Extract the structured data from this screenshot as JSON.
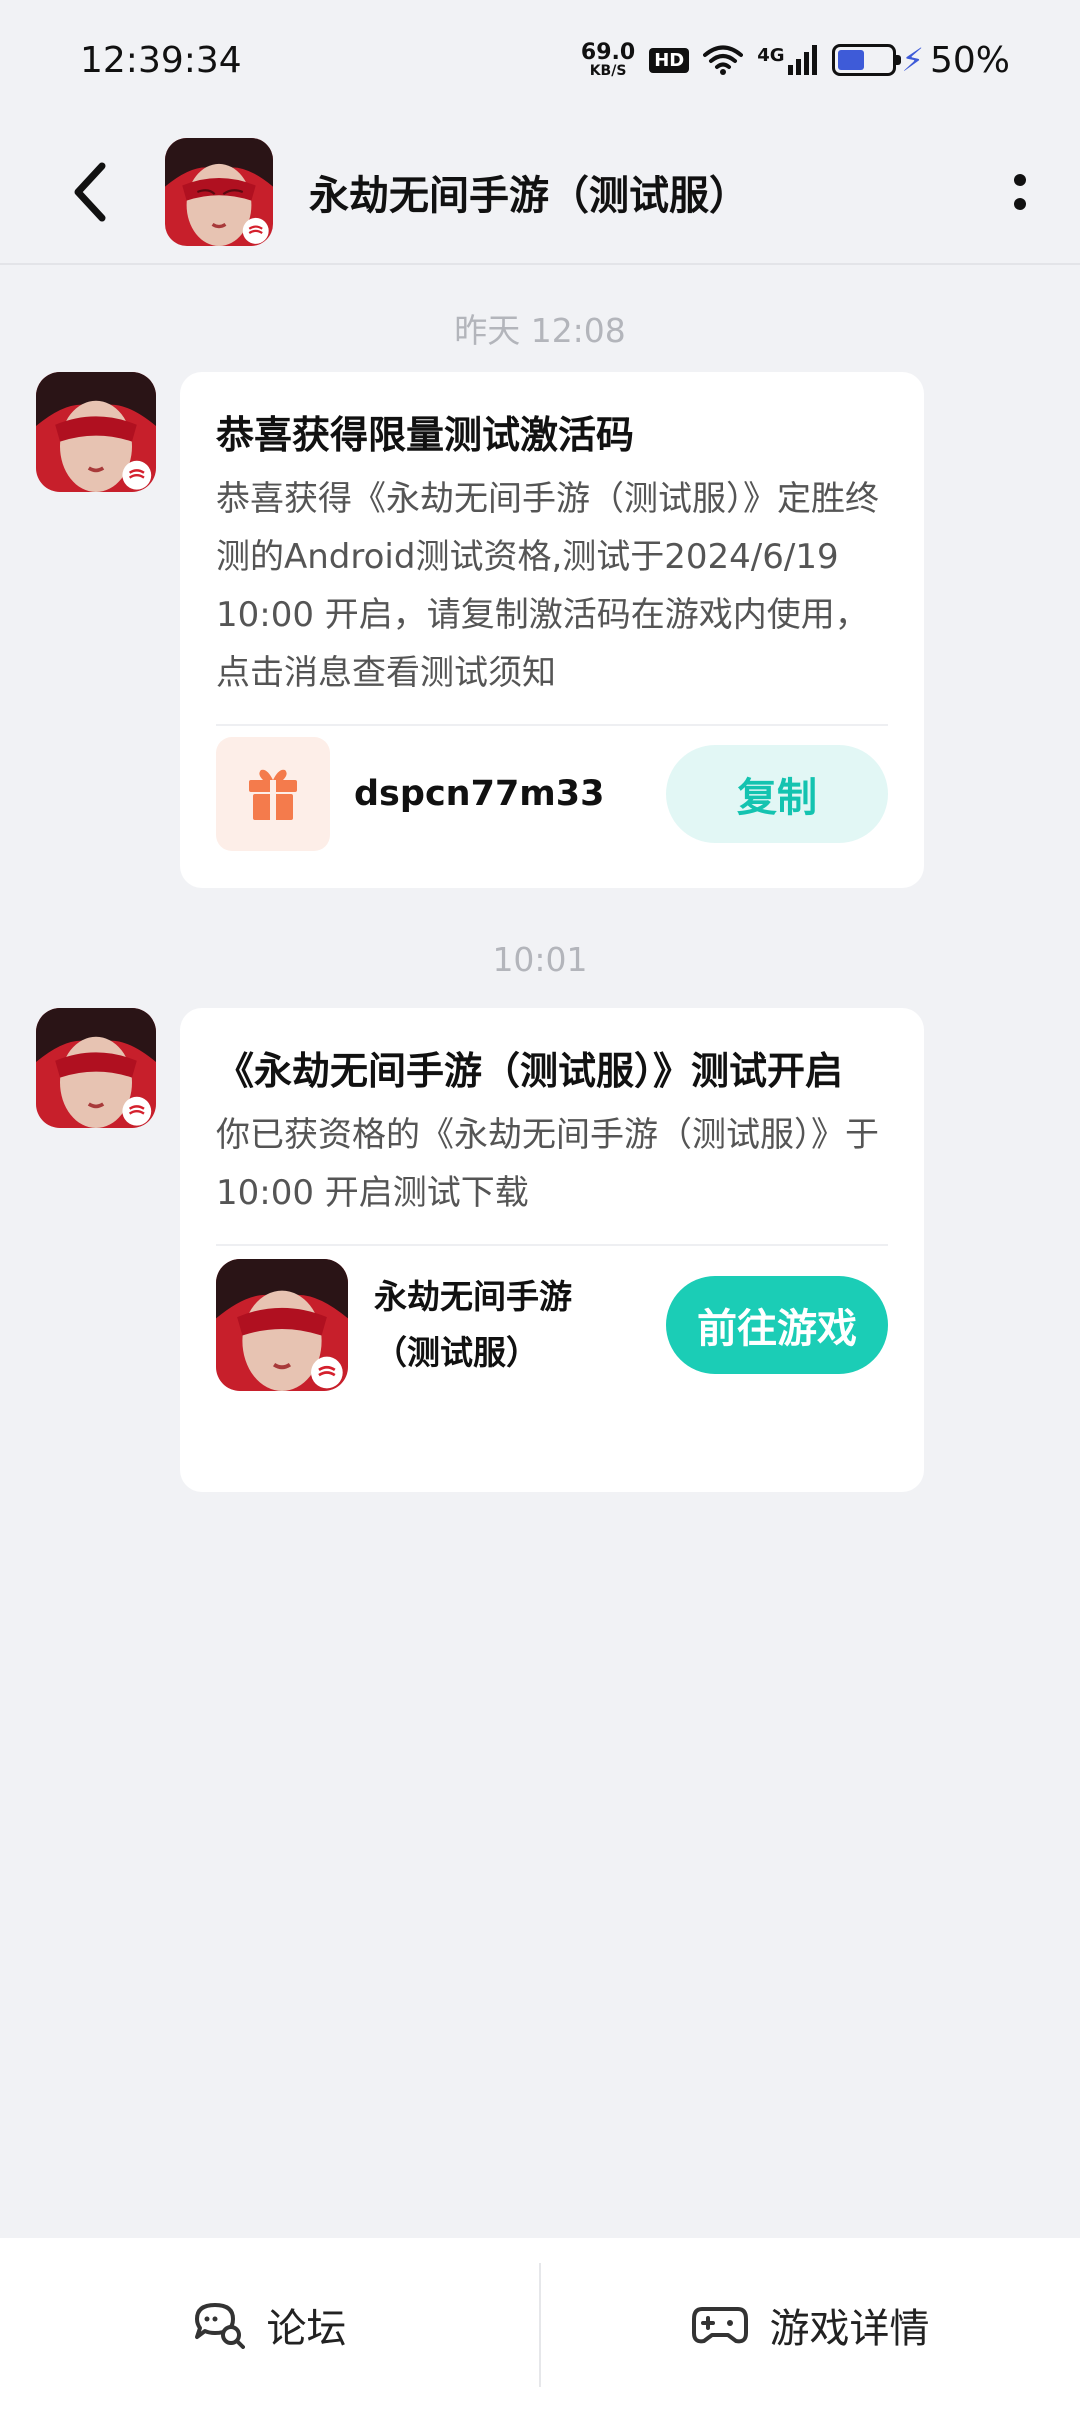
{
  "status_bar": {
    "time": "12:39:34",
    "net_speed_value": "69.0",
    "net_speed_unit": "KB/S",
    "hd_badge": "HD",
    "signal_label": "4G",
    "battery_percent": "50%",
    "battery_level": 0.5,
    "battery_color": "#3e5bd8"
  },
  "header": {
    "title": "永劫无间手游（测试服）",
    "avatar_icon": "game-avatar-icon",
    "back_icon": "chevron-left-icon",
    "more_icon": "more-vertical-icon"
  },
  "messages": [
    {
      "time": "昨天  12:08",
      "title": "恭喜获得限量测试激活码",
      "body": "恭喜获得《永劫无间手游（测试服）》定胜终测的Android测试资格,测试于2024/6/19 10:00 开启，请复制激活码在游戏内使用，点击消息查看测试须知",
      "code_icon": "gift-icon",
      "code": "dspcn77m33",
      "action_label": "复制"
    },
    {
      "time": "10:01",
      "title": "《永劫无间手游（测试服）》测试开启",
      "body": "你已获资格的《永劫无间手游（测试服）》于 10:00 开启测试下载",
      "game_name_line1": "永劫无间手游",
      "game_name_line2": "（测试服）",
      "action_label": "前往游戏"
    }
  ],
  "bottom_bar": {
    "forum_label": "论坛",
    "forum_icon": "chat-search-icon",
    "details_label": "游戏详情",
    "details_icon": "gamepad-icon"
  },
  "colors": {
    "accent": "#1bcdb6",
    "accent_light": "#e2f7f5",
    "gift": "#f47b4c",
    "background": "#f1f2f5"
  }
}
